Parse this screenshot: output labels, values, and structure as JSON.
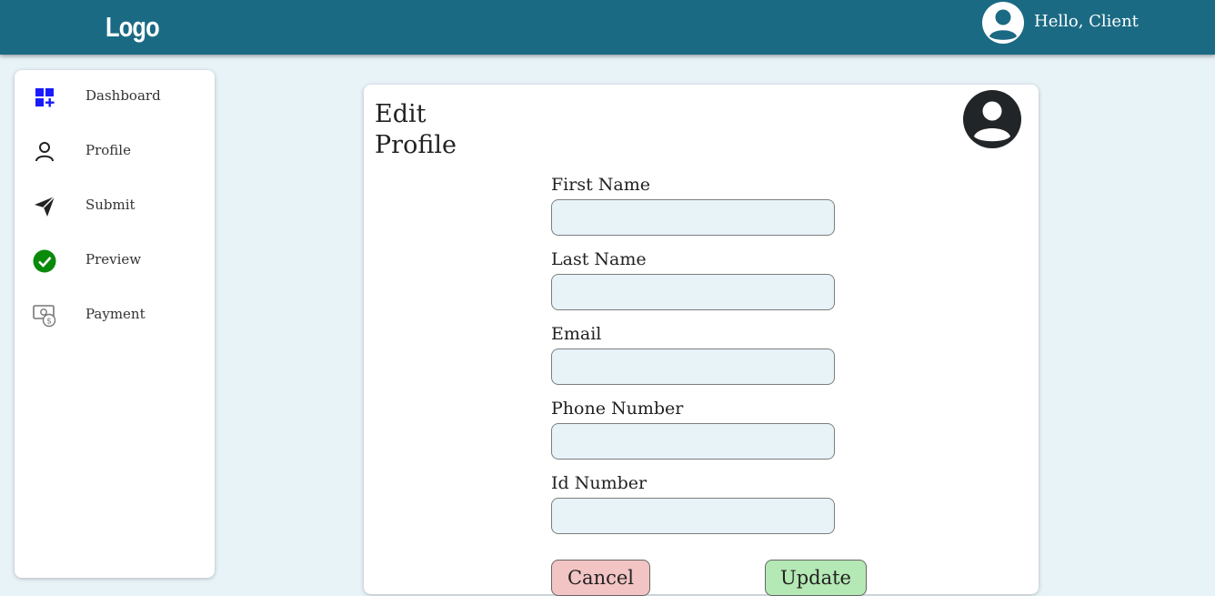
{
  "header": {
    "logo": "Logo",
    "greeting": "Hello, Client",
    "avatar_icon": "account-circle-icon"
  },
  "sidebar": {
    "items": [
      {
        "label": "Dashboard",
        "icon": "dashboard-add-icon",
        "color": "#1a1aff"
      },
      {
        "label": "Profile",
        "icon": "person-outline-icon",
        "color": "#222222"
      },
      {
        "label": "Submit",
        "icon": "send-icon",
        "color": "#222222"
      },
      {
        "label": "Preview",
        "icon": "check-circle-icon",
        "color": "#0a8a0a"
      },
      {
        "label": "Payment",
        "icon": "money-icon",
        "color": "#777777"
      }
    ]
  },
  "form": {
    "title_line1": "Edit",
    "title_line2": "Profile",
    "avatar_icon": "account-circle-icon",
    "fields": [
      {
        "label": "First Name",
        "value": "",
        "placeholder": ""
      },
      {
        "label": "Last Name",
        "value": "",
        "placeholder": ""
      },
      {
        "label": "Email",
        "value": "",
        "placeholder": ""
      },
      {
        "label": "Phone Number",
        "value": "",
        "placeholder": ""
      },
      {
        "label": "Id Number",
        "value": "",
        "placeholder": ""
      }
    ],
    "cancel_label": "Cancel",
    "update_label": "Update"
  },
  "colors": {
    "header_bg": "#1b6a84",
    "page_bg": "#e8f3f8",
    "cancel_bg": "#f2c4c4",
    "update_bg": "#b4e8b4"
  }
}
